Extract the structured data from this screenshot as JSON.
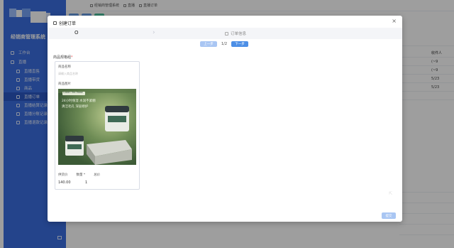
{
  "sidebar": {
    "brand": "经销商管理系统",
    "items": [
      {
        "label": "工作台",
        "level": "top"
      },
      {
        "label": "直播",
        "level": "top"
      },
      {
        "label": "直播直售",
        "level": "sub"
      },
      {
        "label": "直播带货",
        "level": "sub"
      },
      {
        "label": "商品",
        "level": "sub"
      },
      {
        "label": "直播订单",
        "level": "sub"
      },
      {
        "label": "直播结算记录",
        "level": "sub"
      },
      {
        "label": "直播分账记录",
        "level": "sub"
      },
      {
        "label": "直播退款记录",
        "level": "sub"
      }
    ],
    "active_index": 5
  },
  "topbar": {
    "crumbs": [
      "经销商管理系统",
      "直播",
      "直播订单"
    ]
  },
  "background_table": {
    "header": "收件人",
    "values": [
      "(~9",
      "(~9",
      "5/23",
      "5/23"
    ]
  },
  "modal": {
    "title": "创建订单",
    "close": "×",
    "steps": {
      "step1": "O",
      "arrow": "›",
      "step2": "订单信息"
    },
    "pager": {
      "prev": "上一步",
      "count": "1/2",
      "next": "下一步"
    },
    "field_label": "商品规格组",
    "field_required": "*",
    "card": {
      "label1": "商品名称",
      "input_placeholder": "请输入商品名称",
      "label2": "商品图片",
      "image_text_brand": "Green Tea Mask",
      "image_text_line1": "24小时保湿 水润不紧绷",
      "image_text_line2": "清洁毛孔 深层修护",
      "meta_labels": [
        "供货价",
        "数量 *",
        "总价"
      ],
      "meta_values": [
        "140.00",
        "1",
        ""
      ]
    },
    "submit": "提交"
  },
  "colors": {
    "sidebar": "#3b6fe0",
    "primary_button": "#4d8fe6",
    "disabled_button": "#a9c6f3",
    "overlay": "rgba(0,0,0,0.38)"
  }
}
